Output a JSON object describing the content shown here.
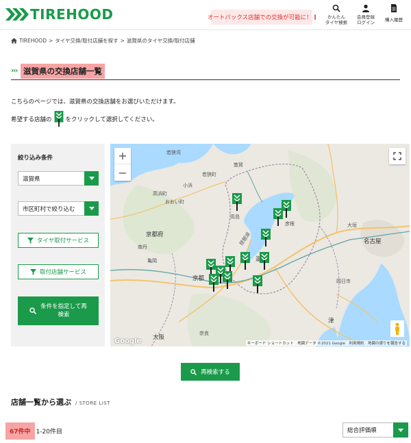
{
  "header": {
    "logo_text": "TIREHOOD",
    "banner_text": "オートバックス店舗での交換が可能に！",
    "nav": [
      {
        "line1": "かんたん",
        "line2": "タイヤ検索",
        "icon": "search-icon"
      },
      {
        "line1": "会員登録",
        "line2": "ログイン",
        "icon": "user-icon"
      },
      {
        "line1": "購入履歴",
        "line2": "",
        "icon": "document-icon"
      }
    ]
  },
  "breadcrumb": {
    "home": "TIREHOOD",
    "sep": ">",
    "items": [
      "タイヤ交換/取付店舗を探す",
      "滋賀県のタイヤ交換/取付店舗"
    ]
  },
  "page_title": "滋賀県の交換店舗一覧",
  "intro": {
    "line1": "こちらのページでは、滋賀県の交換店舗をお選びいただけます。",
    "line2_before": "希望する店舗の",
    "line2_after": "をクリックして選択してください。"
  },
  "filter": {
    "title": "絞り込み条件",
    "prefecture": "滋賀県",
    "city_placeholder": "市区町村で絞り込む",
    "btn_tire_service": "タイヤ取付サービス",
    "btn_store_service": "取付店舗サービス",
    "btn_search_line1": "条件を指定して再",
    "btn_search_line2": "検索"
  },
  "map": {
    "zoom_in": "+",
    "zoom_out": "−",
    "labels": [
      {
        "text": "若狭湾"
      },
      {
        "text": "敦賀"
      },
      {
        "text": "若狭町"
      },
      {
        "text": "小浜"
      },
      {
        "text": "高浜町"
      },
      {
        "text": "おおい町"
      },
      {
        "text": "京都府"
      },
      {
        "text": "高島"
      },
      {
        "text": "琵琶湖"
      },
      {
        "text": "彦根"
      },
      {
        "text": "滋賀"
      },
      {
        "text": "京都"
      },
      {
        "text": "亀岡"
      },
      {
        "text": "南丹"
      },
      {
        "text": "大阪"
      },
      {
        "text": "名古屋"
      },
      {
        "text": "大垣"
      },
      {
        "text": "四日市"
      },
      {
        "text": "津"
      },
      {
        "text": "奈良"
      }
    ],
    "google": "Google",
    "attribution": "キーボード ショートカット　地図データ ©2021 Google　利用規約　地図の誤りを報告する"
  },
  "research_btn": "再検索する",
  "list": {
    "title": "店舗一覧から選ぶ",
    "subtitle": "/ STORE LIST",
    "count": "67件中",
    "range": "1-20件目",
    "sort": "総合評価順"
  },
  "colors": {
    "brand": "#1a9a4a",
    "highlight": "#f6a4a4",
    "banner_text": "#e0302b"
  }
}
